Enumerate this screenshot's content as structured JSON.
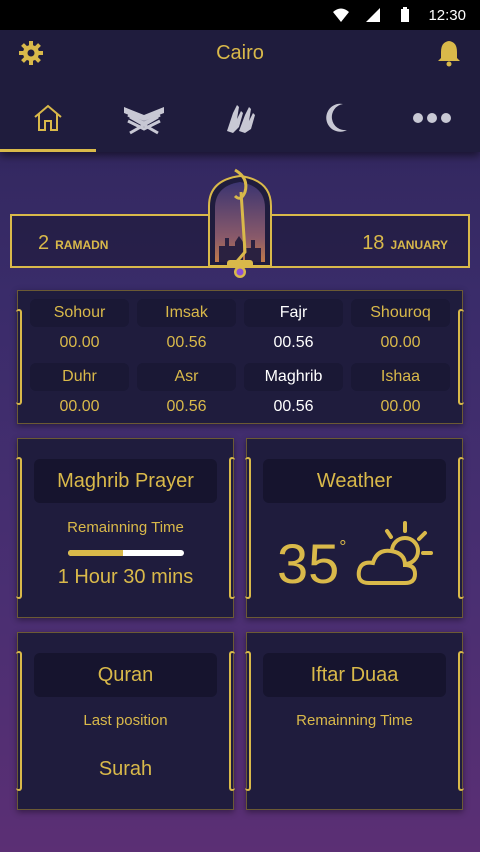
{
  "status_bar": {
    "time": "12:30"
  },
  "header": {
    "city": "Cairo",
    "tabs": [
      {
        "name": "home-icon",
        "active": true
      },
      {
        "name": "quran-icon",
        "active": false
      },
      {
        "name": "dua-hands-icon",
        "active": false
      },
      {
        "name": "crescent-icon",
        "active": false
      },
      {
        "name": "more-icon",
        "active": false
      }
    ]
  },
  "dates": {
    "hijri_day": "2",
    "hijri_month": "RAMADN",
    "greg_day": "18",
    "greg_month": "JANUARY"
  },
  "prayer_times": [
    {
      "name": "Sohour",
      "time": "00.00",
      "current": false
    },
    {
      "name": "Imsak",
      "time": "00.56",
      "current": false
    },
    {
      "name": "Fajr",
      "time": "00.56",
      "current": true
    },
    {
      "name": "Shouroq",
      "time": "00.00",
      "current": false
    },
    {
      "name": "Duhr",
      "time": "00.00",
      "current": false
    },
    {
      "name": "Asr",
      "time": "00.56",
      "current": false
    },
    {
      "name": "Maghrib",
      "time": "00.56",
      "current": true
    },
    {
      "name": "Ishaa",
      "time": "00.00",
      "current": false
    }
  ],
  "next_prayer": {
    "title": "Maghrib Prayer",
    "subtitle": "Remainning Time",
    "remaining": "1 Hour 30 mins",
    "progress_fraction": 0.47
  },
  "weather": {
    "title": "Weather",
    "temperature": "35",
    "unit": "°",
    "icon": "partly-cloudy-icon"
  },
  "quran": {
    "title": "Quran",
    "subtitle": "Last position",
    "value": "Surah"
  },
  "iftar": {
    "title": "Iftar Duaa",
    "subtitle": "Remainning Time"
  },
  "colors": {
    "accent": "#d9b94a",
    "panel": "#1f1c3d",
    "background": "#3a2c6a"
  }
}
